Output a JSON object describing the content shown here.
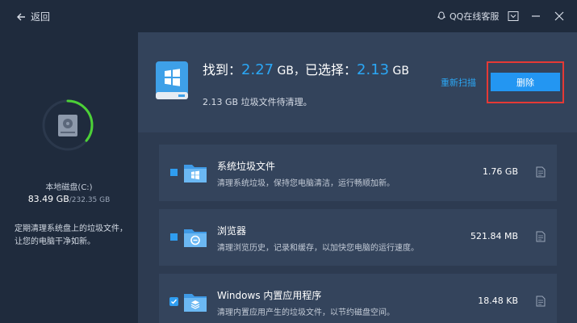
{
  "titlebar": {
    "back_label": "返回",
    "qq_label": "QQ在线客服"
  },
  "disk": {
    "name": "本地磁盘(C:)",
    "used": "83.49 GB",
    "total": "/232.35 GB",
    "usage_fraction": 0.36
  },
  "left_tip": "定期清理系统盘上的垃圾文件，让您的电脑干净如新。",
  "summary": {
    "found_prefix": "找到：",
    "found_value": "2.27",
    "found_unit": " GB，",
    "selected_prefix": "已选择：",
    "selected_value": "2.13",
    "selected_unit": " GB",
    "pending_size": "2.13",
    "pending_text": " GB 垃圾文件待清理。",
    "rescan_label": "重新扫描",
    "delete_label": "删除"
  },
  "items": [
    {
      "name": "系统垃圾文件",
      "desc": "清理系统垃圾，保持您电脑清洁，运行畅顺加新。",
      "size": "1.76 GB",
      "icon": "windows-folder-icon",
      "checked": "partial"
    },
    {
      "name": "浏览器",
      "desc": "清理浏览历史，记录和缓存，以加快您电脑的运行速度。",
      "size": "521.84 MB",
      "icon": "browser-folder-icon",
      "checked": "partial"
    },
    {
      "name": "Windows 内置应用程序",
      "desc": "清理内置应用产生的垃圾文件，以节约磁盘空间。",
      "size": "18.48 KB",
      "icon": "apps-folder-icon",
      "checked": "checked"
    }
  ],
  "colors": {
    "accent": "#2396f2",
    "highlight": "#2ba7f5",
    "ring": "#4cd137",
    "delete_outline": "#e53935"
  }
}
